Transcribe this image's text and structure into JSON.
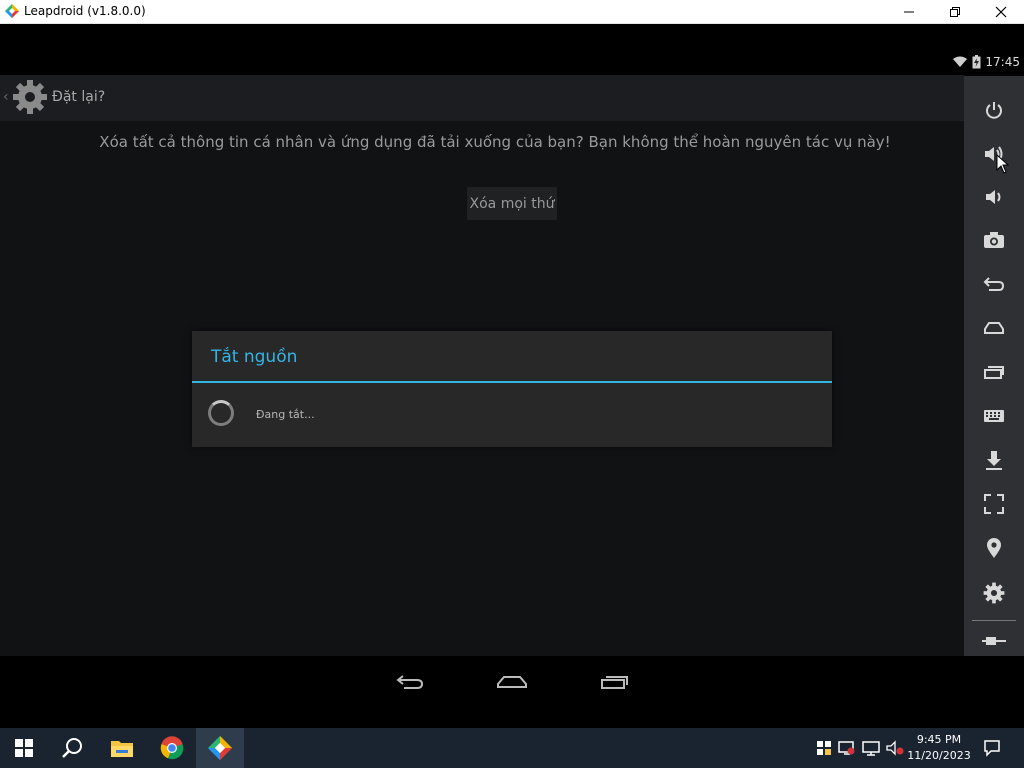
{
  "window": {
    "title": "Leapdroid (v1.8.0.0)",
    "minimize_icon": "minimize-icon",
    "restore_icon": "restore-icon",
    "close_icon": "close-icon"
  },
  "statusbar": {
    "time": "17:45",
    "icons": [
      "wifi-icon",
      "battery-charging-icon"
    ]
  },
  "screen": {
    "header_title": "Đặt lại?",
    "description": "Xóa tất cả thông tin cá nhân và ứng dụng đã tải xuống của bạn? Bạn không thể hoàn nguyên tác vụ này!",
    "erase_button": "Xóa mọi thứ"
  },
  "dialog": {
    "title": "Tắt nguồn",
    "message": "Đang tắt..."
  },
  "nav": [
    "back-icon",
    "home-icon",
    "recents-icon"
  ],
  "sidebar": {
    "items": [
      "power-icon",
      "volume-up-icon",
      "volume-down-icon",
      "camera-icon",
      "back-icon",
      "home-icon",
      "recent-apps-icon",
      "keyboard-icon",
      "download-apk-icon",
      "fullscreen-icon",
      "location-icon",
      "settings-gear-icon",
      "collapse-icon"
    ]
  },
  "taskbar": {
    "apps": [
      "windows-start-icon",
      "search-icon",
      "file-explorer-icon",
      "chrome-icon",
      "leapdroid-icon"
    ],
    "tray_icons": [
      "shield-flag-icon",
      "display-warning-icon",
      "network-icon",
      "volume-muted-icon"
    ],
    "time": "9:45 PM",
    "date": "11/20/2023"
  },
  "colors": {
    "accent": "#33b5e5",
    "screen_bg": "#111214",
    "sidebar_bg": "#2f3033",
    "taskbar_bg": "#1a2330"
  }
}
